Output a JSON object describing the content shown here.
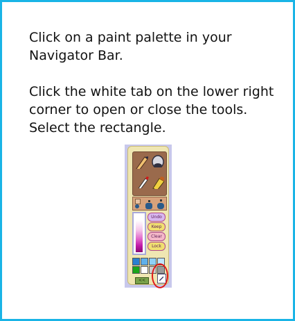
{
  "instructions": {
    "paragraph1": "Click on a paint palette in your Navigator Bar.",
    "paragraph2": "Click the white tab on the lower right corner to open or close the tools. Select the rectangle."
  },
  "palette": {
    "tools": [
      "crayon-icon",
      "paint-bucket-icon",
      "marker-icon",
      "glue-icon"
    ],
    "shapes": [
      "square-icon",
      "small-dot-icon",
      "triangle-icon",
      "octagon-icon",
      "circle-icon",
      "hexagon-icon"
    ],
    "buttons": {
      "undo": "Undo",
      "keep": "Keep",
      "clear": "Clear",
      "lock": "Lock"
    },
    "nav_button_label": "<<",
    "swatch_colors": [
      "#2a7fd0",
      "#5fb0ea",
      "#8ed0f6",
      "#bfe6ff",
      "#1aa51a",
      "#ffffff",
      "#cfcfcf",
      "#9a9a9a"
    ]
  },
  "colors": {
    "frame_border": "#19b4e6",
    "highlight_ring": "#e01818"
  }
}
